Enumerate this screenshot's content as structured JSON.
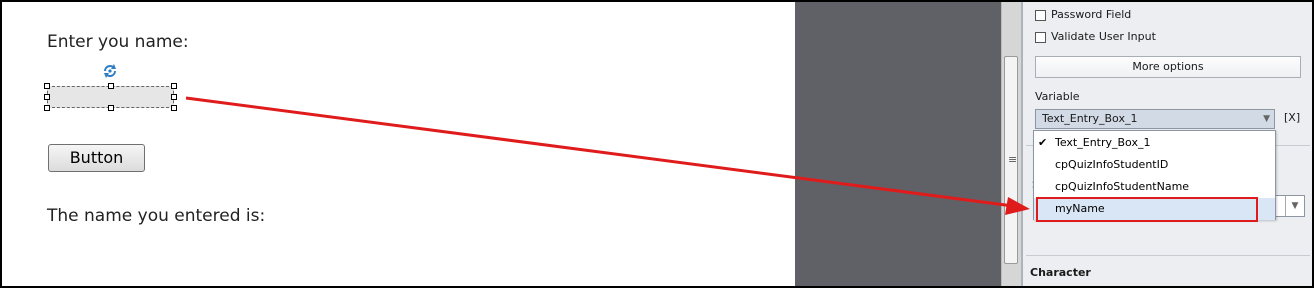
{
  "stage": {
    "label_enter": "Enter you name:",
    "button_label": "Button",
    "label_result": "The name you entered is:"
  },
  "panel": {
    "password_field": "Password Field",
    "validate_input": "Validate User Input",
    "more_options": "More options",
    "variable_label": "Variable",
    "variable_selected": "Text_Entry_Box_1",
    "clear_button": "[X]",
    "partial_letter_1": "I",
    "partial_letter_2": "S",
    "character_heading": "Character"
  },
  "dropdown": {
    "options": [
      "Text_Entry_Box_1",
      "cpQuizInfoStudentID",
      "cpQuizInfoStudentName",
      "myName"
    ],
    "checked_index": 0,
    "highlighted_index": 3
  },
  "colors": {
    "annotation": "#e01b1b",
    "canvas_gray": "#5f6167",
    "panel_bg": "#eceef2"
  },
  "icons": [
    "rotate-icon",
    "checkmark-icon",
    "dropdown-arrow-icon",
    "scroll-grip-icon"
  ]
}
